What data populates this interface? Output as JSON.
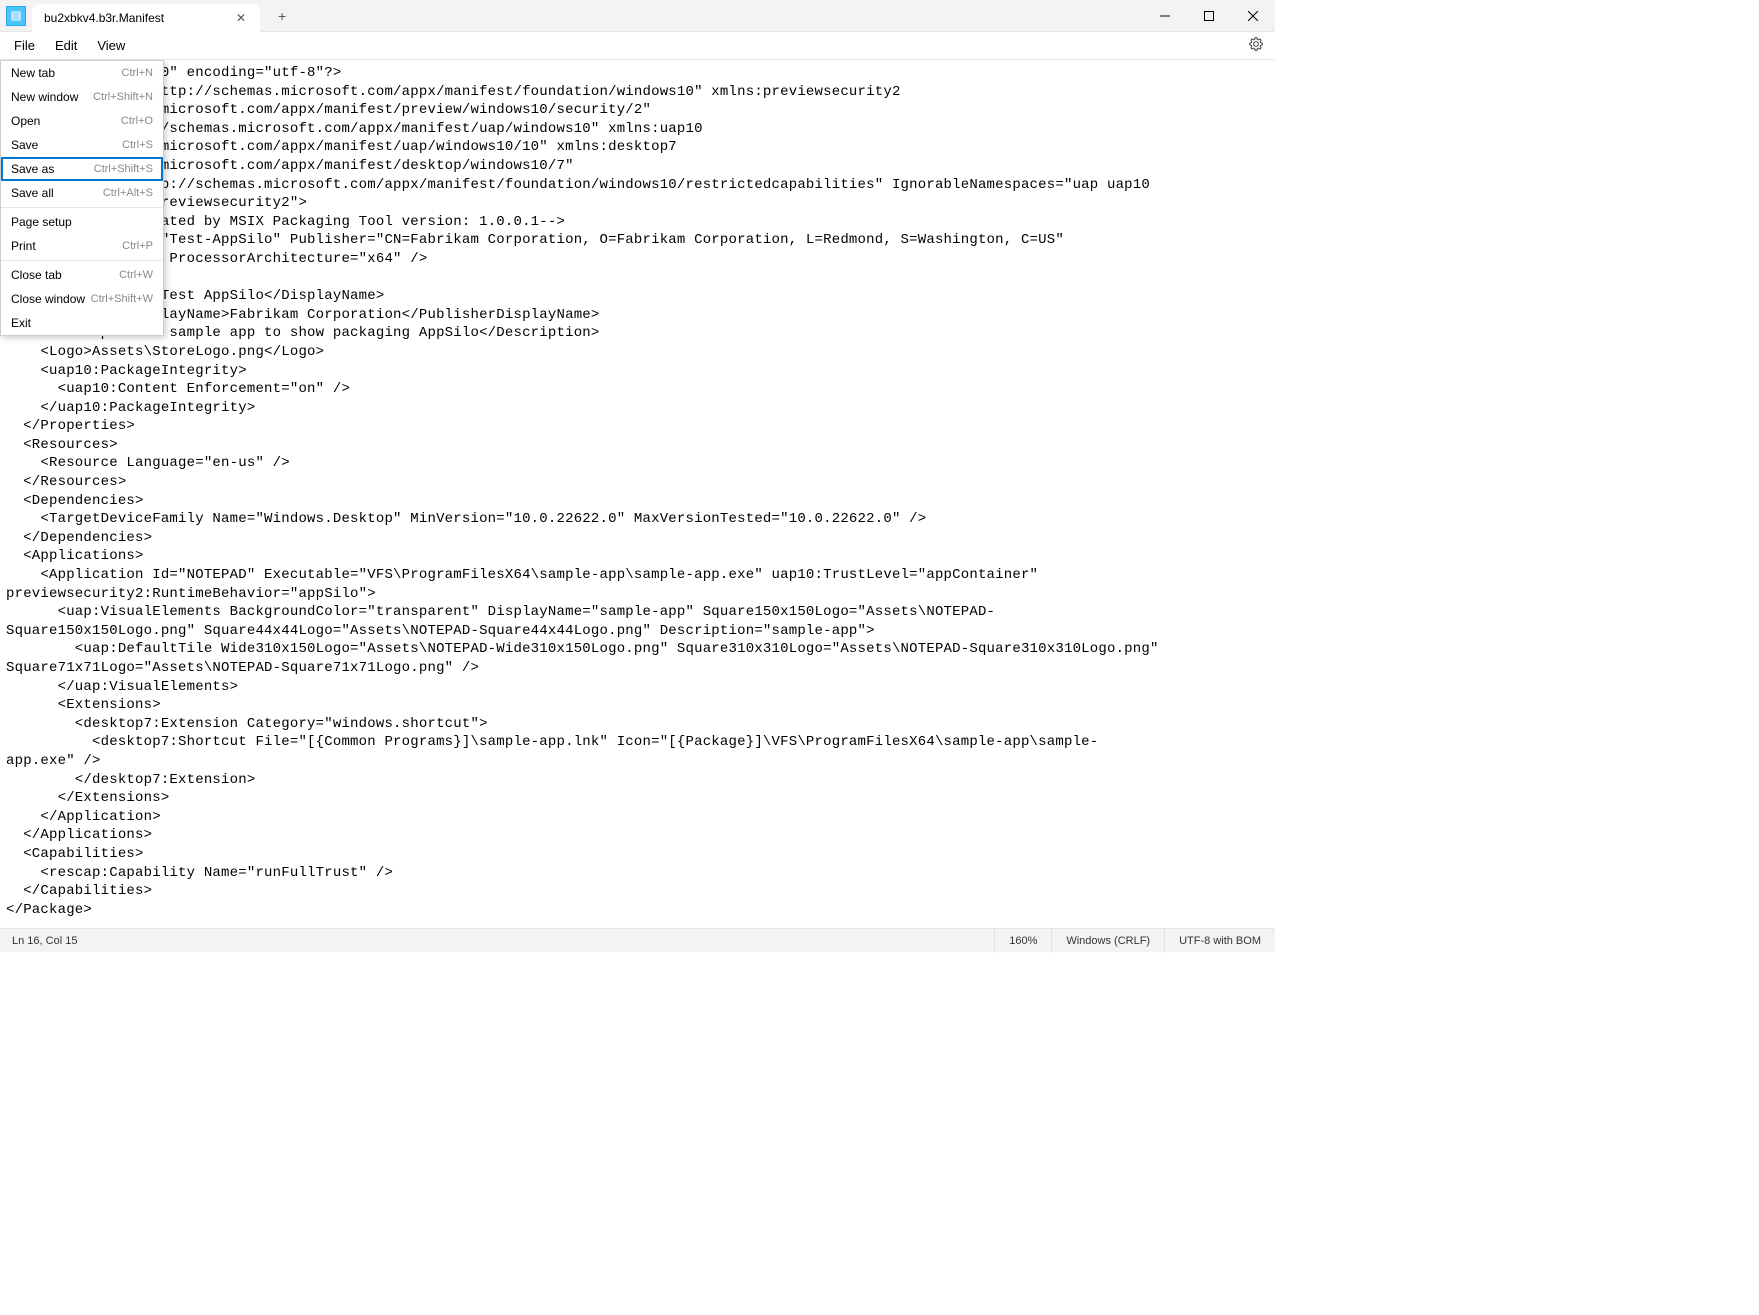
{
  "title_bar": {
    "tab_title": "bu2xbkv4.b3r.Manifest"
  },
  "menu_bar": {
    "file": "File",
    "edit": "Edit",
    "view": "View"
  },
  "file_menu": {
    "items": [
      {
        "label": "New tab",
        "shortcut": "Ctrl+N"
      },
      {
        "label": "New window",
        "shortcut": "Ctrl+Shift+N"
      },
      {
        "label": "Open",
        "shortcut": "Ctrl+O"
      },
      {
        "label": "Save",
        "shortcut": "Ctrl+S"
      },
      {
        "label": "Save as",
        "shortcut": "Ctrl+Shift+S"
      },
      {
        "label": "Save all",
        "shortcut": "Ctrl+Alt+S"
      },
      {
        "label": "Page setup",
        "shortcut": ""
      },
      {
        "label": "Print",
        "shortcut": "Ctrl+P"
      },
      {
        "label": "Close tab",
        "shortcut": "Ctrl+W"
      },
      {
        "label": "Close window",
        "shortcut": "Ctrl+Shift+W"
      },
      {
        "label": "Exit",
        "shortcut": ""
      }
    ]
  },
  "status_bar": {
    "position": "Ln 16, Col 15",
    "zoom": "160%",
    "line_ending": "Windows (CRLF)",
    "encoding": "UTF-8 with BOM"
  },
  "editor": {
    "content": "                  0\" encoding=\"utf-8\"?>\n                  ttp://schemas.microsoft.com/appx/manifest/foundation/windows10\" xmlns:previewsecurity2\n                  microsoft.com/appx/manifest/preview/windows10/security/2\"\n                  /schemas.microsoft.com/appx/manifest/uap/windows10\" xmlns:uap10\n                  microsoft.com/appx/manifest/uap/windows10/10\" xmlns:desktop7\n                  microsoft.com/appx/manifest/desktop/windows10/7\"\n                  p://schemas.microsoft.com/appx/manifest/foundation/windows10/restrictedcapabilities\" IgnorableNamespaces=\"uap uap10\n                  reviewsecurity2\">\n                  ated by MSIX Packaging Tool version: 1.0.0.1-->\n                  \"Test-AppSilo\" Publisher=\"CN=Fabrikam Corporation, O=Fabrikam Corporation, L=Redmond, S=Washington, C=US\"\n                   ProcessorArchitecture=\"x64\" />\n\n                  Test AppSilo</DisplayName>\n    <PublisherDisplayName>Fabrikam Corporation</PublisherDisplayName>\n    <Description>A sample app to show packaging AppSilo</Description>\n    <Logo>Assets\\StoreLogo.png</Logo>\n    <uap10:PackageIntegrity>\n      <uap10:Content Enforcement=\"on\" />\n    </uap10:PackageIntegrity>\n  </Properties>\n  <Resources>\n    <Resource Language=\"en-us\" />\n  </Resources>\n  <Dependencies>\n    <TargetDeviceFamily Name=\"Windows.Desktop\" MinVersion=\"10.0.22622.0\" MaxVersionTested=\"10.0.22622.0\" />\n  </Dependencies>\n  <Applications>\n    <Application Id=\"NOTEPAD\" Executable=\"VFS\\ProgramFilesX64\\sample-app\\sample-app.exe\" uap10:TrustLevel=\"appContainer\"\npreviewsecurity2:RuntimeBehavior=\"appSilo\">\n      <uap:VisualElements BackgroundColor=\"transparent\" DisplayName=\"sample-app\" Square150x150Logo=\"Assets\\NOTEPAD-\nSquare150x150Logo.png\" Square44x44Logo=\"Assets\\NOTEPAD-Square44x44Logo.png\" Description=\"sample-app\">\n        <uap:DefaultTile Wide310x150Logo=\"Assets\\NOTEPAD-Wide310x150Logo.png\" Square310x310Logo=\"Assets\\NOTEPAD-Square310x310Logo.png\"\nSquare71x71Logo=\"Assets\\NOTEPAD-Square71x71Logo.png\" />\n      </uap:VisualElements>\n      <Extensions>\n        <desktop7:Extension Category=\"windows.shortcut\">\n          <desktop7:Shortcut File=\"[{Common Programs}]\\sample-app.lnk\" Icon=\"[{Package}]\\VFS\\ProgramFilesX64\\sample-app\\sample-\napp.exe\" />\n        </desktop7:Extension>\n      </Extensions>\n    </Application>\n  </Applications>\n  <Capabilities>\n    <rescap:Capability Name=\"runFullTrust\" />\n  </Capabilities>\n</Package>"
  }
}
